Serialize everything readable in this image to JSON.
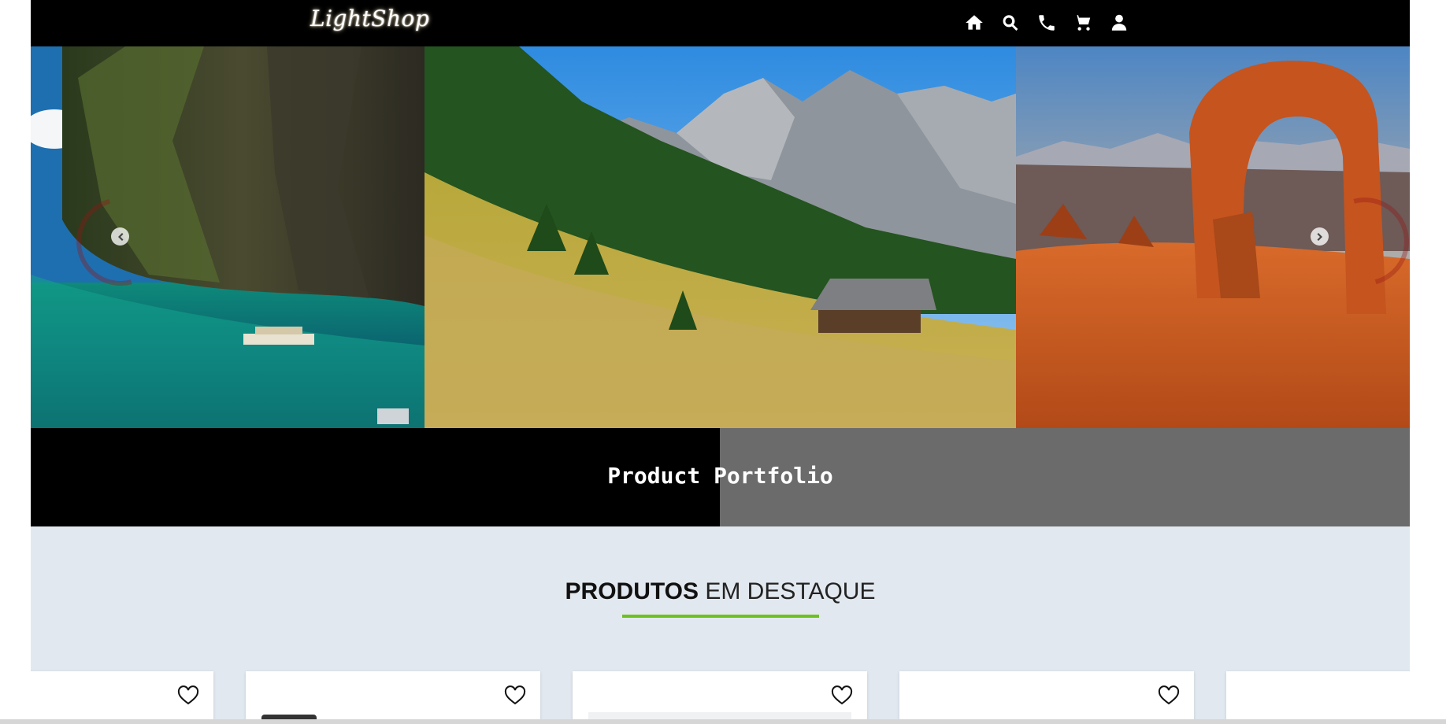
{
  "header": {
    "logo": "LightShop",
    "nav": [
      {
        "name": "home",
        "icon": "home-icon"
      },
      {
        "name": "search",
        "icon": "search-icon"
      },
      {
        "name": "phone",
        "icon": "phone-icon"
      },
      {
        "name": "cart",
        "icon": "cart-icon"
      },
      {
        "name": "account",
        "icon": "user-icon"
      }
    ]
  },
  "carousel": {
    "slides": [
      "tropical-lagoon-cliffs",
      "alpine-meadow-cabin",
      "desert-rock-arch"
    ],
    "prev_icon": "chevron-left-icon",
    "next_icon": "chevron-right-icon"
  },
  "portfolio": {
    "title": "Product Portfolio"
  },
  "featured": {
    "title_bold": "PRODUTOS",
    "title_light": "EM DESTAQUE",
    "accent_color": "#6cc21b",
    "cards_icon": "heart-outline-icon"
  }
}
